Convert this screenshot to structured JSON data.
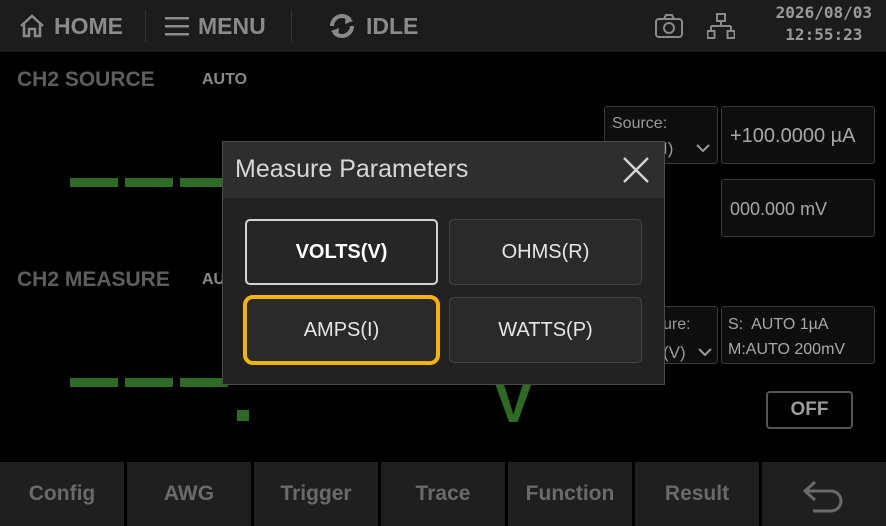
{
  "topbar": {
    "home_label": "HOME",
    "menu_label": "MENU",
    "status_label": "IDLE",
    "date": "2026/08/03",
    "time": "12:55:23"
  },
  "source": {
    "title": "CH2 SOURCE",
    "mode": "AUTO",
    "source_label": "Source:",
    "source_partial": "I)",
    "source_value": "+100.0000 µA",
    "limit_value": "000.000 mV"
  },
  "measure": {
    "title": "CH2 MEASURE",
    "mode_partial": "AU",
    "measure_label_partial": "ure:",
    "measure_partial": "(V)",
    "range_s": "S:  AUTO 1µA",
    "range_m": "M:AUTO 200mV",
    "unit": "V",
    "output_label": "OFF"
  },
  "bottombar": {
    "config": "Config",
    "awg": "AWG",
    "trigger": "Trigger",
    "trace": "Trace",
    "function": "Function",
    "result": "Result"
  },
  "dialog": {
    "title": "Measure Parameters",
    "options": [
      {
        "label": "VOLTS(V)",
        "state": "selected"
      },
      {
        "label": "OHMS(R)",
        "state": "normal"
      },
      {
        "label": "AMPS(I)",
        "state": "focused"
      },
      {
        "label": "WATTS(P)",
        "state": "normal"
      }
    ]
  },
  "colors": {
    "accent_focus": "#f4b400",
    "reading_green": "#2f6a25"
  },
  "icons": [
    "home-icon",
    "menu-icon",
    "refresh-icon",
    "camera-icon",
    "network-icon",
    "chevron-down-icon",
    "close-icon",
    "back-arrow-icon"
  ]
}
